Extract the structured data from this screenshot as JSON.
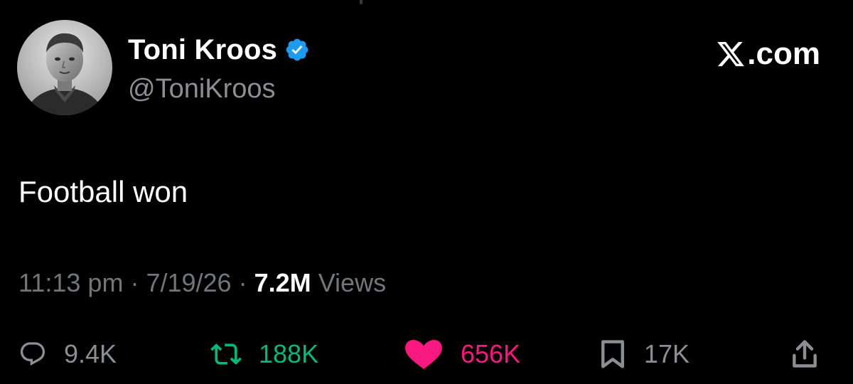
{
  "profile": {
    "display_name": "Toni Kroos",
    "handle": "@ToniKroos",
    "verified": true,
    "verified_icon": "verified-badge-icon",
    "avatar": "profile-photo-avatar"
  },
  "brand": {
    "label": ".com",
    "icon": "x-logo-icon"
  },
  "tweet": {
    "text": "Football won"
  },
  "meta": {
    "time": "11:13 pm",
    "separator": "·",
    "date": "7/19/26",
    "views_count": "7.2M",
    "views_label": "Views"
  },
  "actions": {
    "reply": {
      "icon": "reply-icon",
      "count": "9.4K"
    },
    "retweet": {
      "icon": "retweet-icon",
      "count": "188K"
    },
    "like": {
      "icon": "heart-icon",
      "count": "656K"
    },
    "bookmark": {
      "icon": "bookmark-icon",
      "count": "17K"
    },
    "share": {
      "icon": "share-icon"
    }
  },
  "colors": {
    "background": "#000000",
    "text_primary": "#ffffff",
    "text_secondary": "#71767b",
    "verified_blue": "#1d9bf0",
    "retweet_green": "#00ba7c",
    "like_pink": "#f91880",
    "icon_grey": "#8b8f94"
  }
}
